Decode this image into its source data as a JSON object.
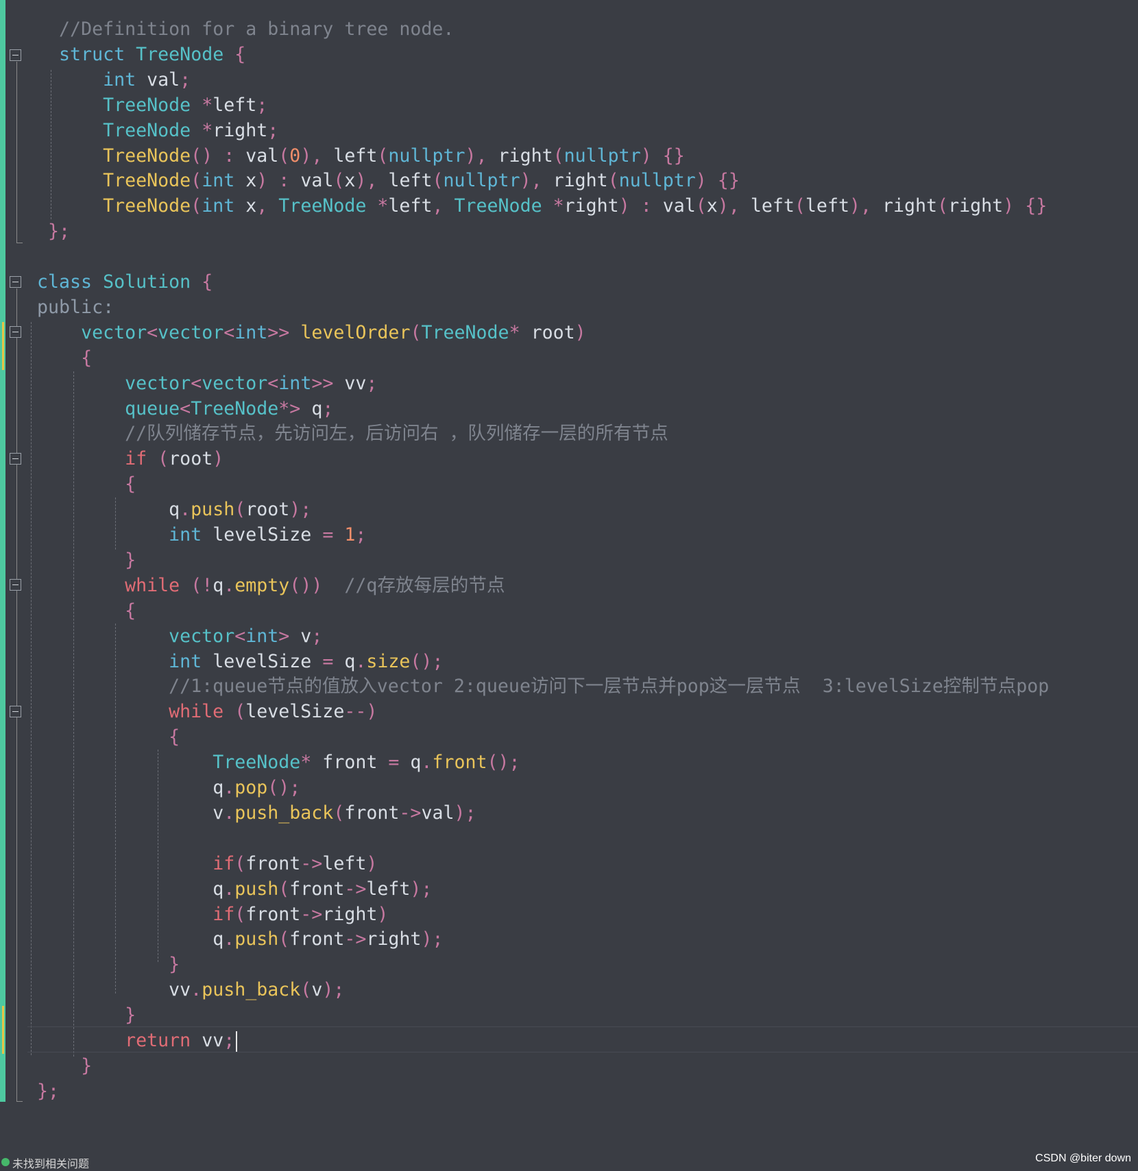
{
  "editor": {
    "lines": [
      {
        "indent": "   ",
        "tokens": [
          [
            "cm",
            "//Definition for a binary tree node."
          ]
        ]
      },
      {
        "indent": "   ",
        "tokens": [
          [
            "kw2",
            "struct"
          ],
          [
            "id",
            " "
          ],
          [
            "ty",
            "TreeNode"
          ],
          [
            "id",
            " "
          ],
          [
            "pu",
            "{"
          ]
        ]
      },
      {
        "indent": "       ",
        "tokens": [
          [
            "kw2",
            "int"
          ],
          [
            "id",
            " val"
          ],
          [
            "pu",
            ";"
          ]
        ]
      },
      {
        "indent": "       ",
        "tokens": [
          [
            "ty",
            "TreeNode"
          ],
          [
            "id",
            " "
          ],
          [
            "pu",
            "*"
          ],
          [
            "id",
            "left"
          ],
          [
            "pu",
            ";"
          ]
        ]
      },
      {
        "indent": "       ",
        "tokens": [
          [
            "ty",
            "TreeNode"
          ],
          [
            "id",
            " "
          ],
          [
            "pu",
            "*"
          ],
          [
            "id",
            "right"
          ],
          [
            "pu",
            ";"
          ]
        ]
      },
      {
        "indent": "       ",
        "tokens": [
          [
            "fn",
            "TreeNode"
          ],
          [
            "pu",
            "()"
          ],
          [
            "id",
            " "
          ],
          [
            "pu",
            ":"
          ],
          [
            "id",
            " val"
          ],
          [
            "pu",
            "("
          ],
          [
            "nu",
            "0"
          ],
          [
            "pu",
            "),"
          ],
          [
            "id",
            " left"
          ],
          [
            "pu",
            "("
          ],
          [
            "kw2",
            "nullptr"
          ],
          [
            "pu",
            "),"
          ],
          [
            "id",
            " right"
          ],
          [
            "pu",
            "("
          ],
          [
            "kw2",
            "nullptr"
          ],
          [
            "pu",
            ")"
          ],
          [
            "id",
            " "
          ],
          [
            "pu",
            "{}"
          ]
        ]
      },
      {
        "indent": "       ",
        "tokens": [
          [
            "fn",
            "TreeNode"
          ],
          [
            "pu",
            "("
          ],
          [
            "kw2",
            "int"
          ],
          [
            "id",
            " x"
          ],
          [
            "pu",
            ")"
          ],
          [
            "id",
            " "
          ],
          [
            "pu",
            ":"
          ],
          [
            "id",
            " val"
          ],
          [
            "pu",
            "("
          ],
          [
            "id",
            "x"
          ],
          [
            "pu",
            "),"
          ],
          [
            "id",
            " left"
          ],
          [
            "pu",
            "("
          ],
          [
            "kw2",
            "nullptr"
          ],
          [
            "pu",
            "),"
          ],
          [
            "id",
            " right"
          ],
          [
            "pu",
            "("
          ],
          [
            "kw2",
            "nullptr"
          ],
          [
            "pu",
            ")"
          ],
          [
            "id",
            " "
          ],
          [
            "pu",
            "{}"
          ]
        ]
      },
      {
        "indent": "       ",
        "tokens": [
          [
            "fn",
            "TreeNode"
          ],
          [
            "pu",
            "("
          ],
          [
            "kw2",
            "int"
          ],
          [
            "id",
            " x"
          ],
          [
            "pu",
            ","
          ],
          [
            "id",
            " "
          ],
          [
            "ty",
            "TreeNode"
          ],
          [
            "id",
            " "
          ],
          [
            "pu",
            "*"
          ],
          [
            "id",
            "left"
          ],
          [
            "pu",
            ","
          ],
          [
            "id",
            " "
          ],
          [
            "ty",
            "TreeNode"
          ],
          [
            "id",
            " "
          ],
          [
            "pu",
            "*"
          ],
          [
            "id",
            "right"
          ],
          [
            "pu",
            ")"
          ],
          [
            "id",
            " "
          ],
          [
            "pu",
            ":"
          ],
          [
            "id",
            " val"
          ],
          [
            "pu",
            "("
          ],
          [
            "id",
            "x"
          ],
          [
            "pu",
            "),"
          ],
          [
            "id",
            " left"
          ],
          [
            "pu",
            "("
          ],
          [
            "id",
            "left"
          ],
          [
            "pu",
            "),"
          ],
          [
            "id",
            " right"
          ],
          [
            "pu",
            "("
          ],
          [
            "id",
            "right"
          ],
          [
            "pu",
            ")"
          ],
          [
            "id",
            " "
          ],
          [
            "pu",
            "{}"
          ]
        ]
      },
      {
        "indent": "  ",
        "tokens": [
          [
            "pu",
            "};"
          ]
        ]
      },
      {
        "indent": "",
        "tokens": []
      },
      {
        "indent": " ",
        "tokens": [
          [
            "kw2",
            "class"
          ],
          [
            "id",
            " "
          ],
          [
            "ty",
            "Solution"
          ],
          [
            "id",
            " "
          ],
          [
            "pu",
            "{"
          ]
        ]
      },
      {
        "indent": " ",
        "tokens": [
          [
            "ac",
            "public:"
          ]
        ]
      },
      {
        "indent": "     ",
        "tokens": [
          [
            "ty",
            "vector"
          ],
          [
            "pu",
            "<"
          ],
          [
            "ty",
            "vector"
          ],
          [
            "pu",
            "<"
          ],
          [
            "kw2",
            "int"
          ],
          [
            "pu",
            ">>"
          ],
          [
            "id",
            " "
          ],
          [
            "fn",
            "levelOrder"
          ],
          [
            "pu",
            "("
          ],
          [
            "ty",
            "TreeNode"
          ],
          [
            "pu",
            "*"
          ],
          [
            "id",
            " root"
          ],
          [
            "pu",
            ")"
          ]
        ]
      },
      {
        "indent": "     ",
        "tokens": [
          [
            "pu",
            "{"
          ]
        ]
      },
      {
        "indent": "         ",
        "tokens": [
          [
            "ty",
            "vector"
          ],
          [
            "pu",
            "<"
          ],
          [
            "ty",
            "vector"
          ],
          [
            "pu",
            "<"
          ],
          [
            "kw2",
            "int"
          ],
          [
            "pu",
            ">>"
          ],
          [
            "id",
            " vv"
          ],
          [
            "pu",
            ";"
          ]
        ]
      },
      {
        "indent": "         ",
        "tokens": [
          [
            "ty",
            "queue"
          ],
          [
            "pu",
            "<"
          ],
          [
            "ty",
            "TreeNode"
          ],
          [
            "pu",
            "*>"
          ],
          [
            "id",
            " q"
          ],
          [
            "pu",
            ";"
          ]
        ]
      },
      {
        "indent": "         ",
        "tokens": [
          [
            "cm",
            "//队列储存节点，先访问左，后访问右 ，队列储存一层的所有节点"
          ]
        ]
      },
      {
        "indent": "         ",
        "tokens": [
          [
            "kw",
            "if"
          ],
          [
            "id",
            " "
          ],
          [
            "pu",
            "("
          ],
          [
            "id",
            "root"
          ],
          [
            "pu",
            ")"
          ]
        ]
      },
      {
        "indent": "         ",
        "tokens": [
          [
            "pu",
            "{"
          ]
        ]
      },
      {
        "indent": "             ",
        "tokens": [
          [
            "id",
            "q"
          ],
          [
            "pu",
            "."
          ],
          [
            "fn",
            "push"
          ],
          [
            "pu",
            "("
          ],
          [
            "id",
            "root"
          ],
          [
            "pu",
            ");"
          ]
        ]
      },
      {
        "indent": "             ",
        "tokens": [
          [
            "kw2",
            "int"
          ],
          [
            "id",
            " levelSize "
          ],
          [
            "pu",
            "="
          ],
          [
            "id",
            " "
          ],
          [
            "nu",
            "1"
          ],
          [
            "pu",
            ";"
          ]
        ]
      },
      {
        "indent": "         ",
        "tokens": [
          [
            "pu",
            "}"
          ]
        ]
      },
      {
        "indent": "         ",
        "tokens": [
          [
            "kw",
            "while"
          ],
          [
            "id",
            " "
          ],
          [
            "pu",
            "(!"
          ],
          [
            "id",
            "q"
          ],
          [
            "pu",
            "."
          ],
          [
            "fn",
            "empty"
          ],
          [
            "pu",
            "())"
          ],
          [
            "id",
            "  "
          ],
          [
            "cm",
            "//q存放每层的节点"
          ]
        ]
      },
      {
        "indent": "         ",
        "tokens": [
          [
            "pu",
            "{"
          ]
        ]
      },
      {
        "indent": "             ",
        "tokens": [
          [
            "ty",
            "vector"
          ],
          [
            "pu",
            "<"
          ],
          [
            "kw2",
            "int"
          ],
          [
            "pu",
            ">"
          ],
          [
            "id",
            " v"
          ],
          [
            "pu",
            ";"
          ]
        ]
      },
      {
        "indent": "             ",
        "tokens": [
          [
            "kw2",
            "int"
          ],
          [
            "id",
            " levelSize "
          ],
          [
            "pu",
            "="
          ],
          [
            "id",
            " q"
          ],
          [
            "pu",
            "."
          ],
          [
            "fn",
            "size"
          ],
          [
            "pu",
            "();"
          ]
        ]
      },
      {
        "indent": "             ",
        "tokens": [
          [
            "cm",
            "//1:queue节点的值放入vector 2:queue访问下一层节点并pop这一层节点  3:levelSize控制节点pop"
          ]
        ]
      },
      {
        "indent": "             ",
        "tokens": [
          [
            "kw",
            "while"
          ],
          [
            "id",
            " "
          ],
          [
            "pu",
            "("
          ],
          [
            "id",
            "levelSize"
          ],
          [
            "pu",
            "--)"
          ]
        ]
      },
      {
        "indent": "             ",
        "tokens": [
          [
            "pu",
            "{"
          ]
        ]
      },
      {
        "indent": "                 ",
        "tokens": [
          [
            "ty",
            "TreeNode"
          ],
          [
            "pu",
            "*"
          ],
          [
            "id",
            " front "
          ],
          [
            "pu",
            "="
          ],
          [
            "id",
            " q"
          ],
          [
            "pu",
            "."
          ],
          [
            "fn",
            "front"
          ],
          [
            "pu",
            "();"
          ]
        ]
      },
      {
        "indent": "                 ",
        "tokens": [
          [
            "id",
            "q"
          ],
          [
            "pu",
            "."
          ],
          [
            "fn",
            "pop"
          ],
          [
            "pu",
            "();"
          ]
        ]
      },
      {
        "indent": "                 ",
        "tokens": [
          [
            "id",
            "v"
          ],
          [
            "pu",
            "."
          ],
          [
            "fn",
            "push_back"
          ],
          [
            "pu",
            "("
          ],
          [
            "id",
            "front"
          ],
          [
            "pu",
            "->"
          ],
          [
            "id",
            "val"
          ],
          [
            "pu",
            ");"
          ]
        ]
      },
      {
        "indent": "",
        "tokens": []
      },
      {
        "indent": "                 ",
        "tokens": [
          [
            "kw",
            "if"
          ],
          [
            "pu",
            "("
          ],
          [
            "id",
            "front"
          ],
          [
            "pu",
            "->"
          ],
          [
            "id",
            "left"
          ],
          [
            "pu",
            ")"
          ]
        ]
      },
      {
        "indent": "                 ",
        "tokens": [
          [
            "id",
            "q"
          ],
          [
            "pu",
            "."
          ],
          [
            "fn",
            "push"
          ],
          [
            "pu",
            "("
          ],
          [
            "id",
            "front"
          ],
          [
            "pu",
            "->"
          ],
          [
            "id",
            "left"
          ],
          [
            "pu",
            ");"
          ]
        ]
      },
      {
        "indent": "                 ",
        "tokens": [
          [
            "kw",
            "if"
          ],
          [
            "pu",
            "("
          ],
          [
            "id",
            "front"
          ],
          [
            "pu",
            "->"
          ],
          [
            "id",
            "right"
          ],
          [
            "pu",
            ")"
          ]
        ]
      },
      {
        "indent": "                 ",
        "tokens": [
          [
            "id",
            "q"
          ],
          [
            "pu",
            "."
          ],
          [
            "fn",
            "push"
          ],
          [
            "pu",
            "("
          ],
          [
            "id",
            "front"
          ],
          [
            "pu",
            "->"
          ],
          [
            "id",
            "right"
          ],
          [
            "pu",
            ");"
          ]
        ]
      },
      {
        "indent": "             ",
        "tokens": [
          [
            "pu",
            "}"
          ]
        ]
      },
      {
        "indent": "             ",
        "tokens": [
          [
            "id",
            "vv"
          ],
          [
            "pu",
            "."
          ],
          [
            "fn",
            "push_back"
          ],
          [
            "pu",
            "("
          ],
          [
            "id",
            "v"
          ],
          [
            "pu",
            ");"
          ]
        ]
      },
      {
        "indent": "         ",
        "tokens": [
          [
            "pu",
            "}"
          ]
        ]
      },
      {
        "indent": "         ",
        "tokens": [
          [
            "kw",
            "return"
          ],
          [
            "id",
            " vv"
          ],
          [
            "pu",
            ";"
          ]
        ]
      },
      {
        "indent": "     ",
        "tokens": [
          [
            "pu",
            "}"
          ]
        ]
      },
      {
        "indent": " ",
        "tokens": [
          [
            "pu",
            "};"
          ]
        ]
      }
    ]
  },
  "status": {
    "message": "未找到相关问题",
    "watermark": "CSDN @biter down"
  },
  "colors": {
    "background": "#3a3d44",
    "comment": "#7f848e",
    "keyword_control": "#e06c75",
    "keyword": "#5fb6d6",
    "type": "#56c1c8",
    "function": "#e9c45a",
    "punctuation": "#c678a0",
    "number": "#f08e6a",
    "identifier": "#d8dde4",
    "change_bar": "#4ec9a0"
  }
}
